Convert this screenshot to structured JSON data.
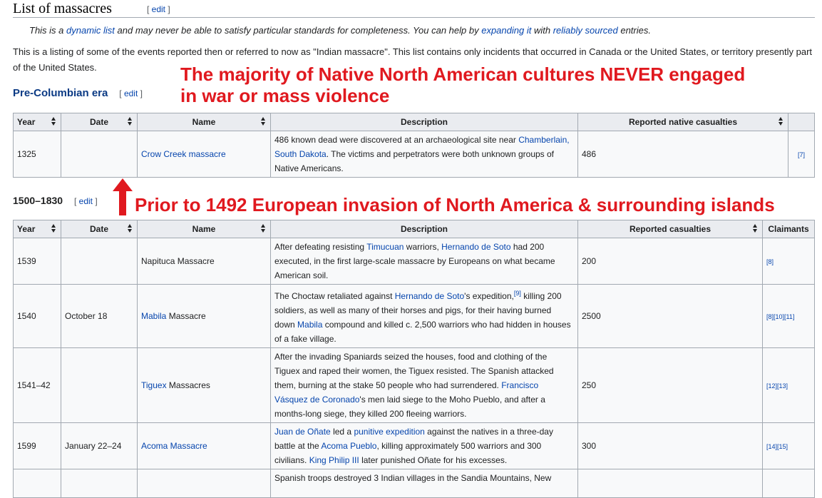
{
  "section": {
    "title": "List of massacres",
    "edit_open": "[ ",
    "edit": "edit",
    "edit_close": " ]"
  },
  "hatnote": {
    "t1": "This is a ",
    "l1": "dynamic list",
    "t2": " and may never be able to satisfy particular standards for completeness. You can help by ",
    "l2": "expanding it",
    "t3": " with ",
    "l3": "reliably sourced",
    "t4": " entries."
  },
  "intro": "This is a listing of some of the events reported then or referred to now as \"Indian massacre\". This list contains only incidents that occurred in Canada or the United States, or territory presently part of the United States.",
  "precolumbian": {
    "title": "Pre-Columbian era",
    "headers": [
      "Year",
      "Date",
      "Name",
      "Description",
      "Reported native casualties",
      ""
    ],
    "row": {
      "year": "1325",
      "date": "",
      "name": "Crow Creek massacre",
      "d1": "486 known dead were discovered at an archaeological site near ",
      "l1": "Chamberlain, South Dakota",
      "d2": ". The victims and perpetrators were both unknown groups of Native Americans.",
      "casualties": "486",
      "ref": "[7]"
    }
  },
  "early": {
    "title": "1500–1830",
    "headers": [
      "Year",
      "Date",
      "Name",
      "Description",
      "Reported casualties",
      "Claimants"
    ],
    "rows": [
      {
        "year": "1539",
        "date": "",
        "name_link": "",
        "name_text": "Napituca Massacre",
        "d1": "After defeating resisting ",
        "l1": "Timucuan",
        "d2": " warriors, ",
        "l2": "Hernando de Soto",
        "d3": " had 200 executed, in the first large-scale massacre by Europeans on what became American soil.",
        "casualties": "200",
        "refs": "[8]"
      },
      {
        "year": "1540",
        "date": "October 18",
        "name_link": "Mabila",
        "name_text": " Massacre",
        "d1": "The Choctaw retaliated against ",
        "l1": "Hernando de Soto",
        "d2": "'s expedition,",
        "sup": "[9]",
        "d3": " killing 200 soldiers, as well as many of their horses and pigs, for their having burned down ",
        "l2": "Mabila",
        "d4": " compound and killed c. 2,500 warriors who had hidden in houses of a fake village.",
        "casualties": "2500",
        "refs": "[8][10][11]"
      },
      {
        "year": "1541–42",
        "date": "",
        "name_link": "Tiguex",
        "name_text": " Massacres",
        "d1": "After the invading Spaniards seized the houses, food and clothing of the Tiguex and raped their women, the Tiguex resisted. The Spanish attacked them, burning at the stake 50 people who had surrendered. ",
        "l1": "Francisco Vásquez de Coronado",
        "d2": "'s men laid siege to the Moho Pueblo, and after a months-long siege, they killed 200 fleeing warriors.",
        "casualties": "250",
        "refs": "[12][13]"
      },
      {
        "year": "1599",
        "date": "January 22–24",
        "name_link": "Acoma Massacre",
        "name_text": "",
        "l1": "Juan de Oñate",
        "d1": " led a ",
        "l2": "punitive expedition",
        "d2": " against the natives in a three-day battle at the ",
        "l3": "Acoma Pueblo",
        "d3": ", killing approximately 500 warriors and 300 civilians. ",
        "l4": "King Philip III",
        "d4": " later punished Oñate for his excesses.",
        "casualties": "300",
        "refs": "[14][15]"
      }
    ],
    "cutoff_text": "Spanish troops destroyed 3 Indian villages in the Sandia Mountains, New"
  },
  "annotations": {
    "a1_line1": "The majority of Native North American cultures NEVER engaged",
    "a1_line2": "in war or mass violence",
    "a2": "Prior to 1492 European invasion of North America & surrounding islands",
    "color": "#e0191f"
  }
}
